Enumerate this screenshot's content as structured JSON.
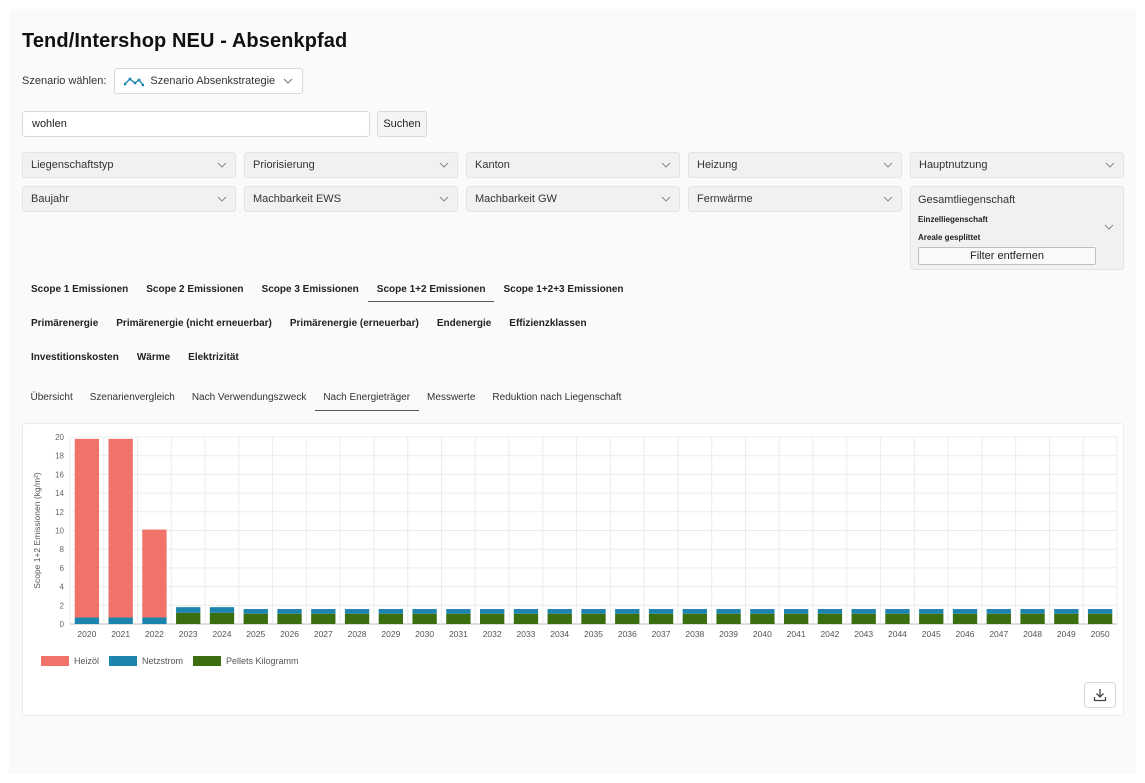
{
  "title": "Tend/Intershop NEU - Absenkpfad",
  "scenario": {
    "label": "Szenario wählen:",
    "selected": "Szenario Absenkstrategie",
    "icon": "line-chart-icon"
  },
  "search": {
    "value": "wohlen",
    "button": "Suchen"
  },
  "filters": {
    "row1": [
      "Liegenschaftstyp",
      "Priorisierung",
      "Kanton",
      "Heizung",
      "Hauptnutzung"
    ],
    "row2": [
      "Baujahr",
      "Machbarkeit EWS",
      "Machbarkeit GW",
      "Fernwärme"
    ],
    "gesamt": {
      "title": "Gesamtliegenschaft",
      "options": [
        "Einzelliegenschaft",
        "Areale gesplittet"
      ],
      "remove_button": "Filter entfernen"
    }
  },
  "metric_tabs": {
    "row1": [
      "Scope 1 Emissionen",
      "Scope 2 Emissionen",
      "Scope 3 Emissionen",
      "Scope 1+2 Emissionen",
      "Scope 1+2+3 Emissionen"
    ],
    "row2": [
      "Primärenergie",
      "Primärenergie (nicht erneuerbar)",
      "Primärenergie (erneuerbar)",
      "Endenergie",
      "Effizienzklassen"
    ],
    "row3": [
      "Investitionskosten",
      "Wärme",
      "Elektrizität"
    ],
    "active": "Scope 1+2 Emissionen"
  },
  "view_tabs": {
    "items": [
      "Übersicht",
      "Szenarienvergleich",
      "Nach Verwendungszweck",
      "Nach Energieträger",
      "Messwerte",
      "Reduktion nach Liegenschaft"
    ],
    "active": "Nach Energieträger"
  },
  "chart_data": {
    "type": "bar",
    "stacked": true,
    "ylabel": "Scope 1+2 Emissionen (kg/m²)",
    "xlabel": "",
    "ylim": [
      0,
      20
    ],
    "yticks": [
      0,
      2,
      4,
      6,
      8,
      10,
      12,
      14,
      16,
      18,
      20
    ],
    "grid": true,
    "legend": "bottom-left",
    "categories": [
      "2020",
      "2021",
      "2022",
      "2023",
      "2024",
      "2025",
      "2026",
      "2027",
      "2028",
      "2029",
      "2030",
      "2031",
      "2032",
      "2033",
      "2034",
      "2035",
      "2036",
      "2037",
      "2038",
      "2039",
      "2040",
      "2041",
      "2042",
      "2043",
      "2044",
      "2045",
      "2046",
      "2047",
      "2048",
      "2049",
      "2050"
    ],
    "series": [
      {
        "name": "Pellets Kilogramm",
        "color": "#3a6e0f",
        "values": [
          0,
          0,
          0,
          1.2,
          1.2,
          1.1,
          1.1,
          1.1,
          1.1,
          1.1,
          1.1,
          1.1,
          1.1,
          1.1,
          1.1,
          1.1,
          1.1,
          1.1,
          1.1,
          1.1,
          1.1,
          1.1,
          1.1,
          1.1,
          1.1,
          1.1,
          1.1,
          1.1,
          1.1,
          1.1,
          1.1
        ]
      },
      {
        "name": "Netzstrom",
        "color": "#1c84ad",
        "values": [
          0.7,
          0.7,
          0.7,
          0.6,
          0.6,
          0.5,
          0.5,
          0.5,
          0.5,
          0.5,
          0.5,
          0.5,
          0.5,
          0.5,
          0.5,
          0.5,
          0.5,
          0.5,
          0.5,
          0.5,
          0.5,
          0.5,
          0.5,
          0.5,
          0.5,
          0.5,
          0.5,
          0.5,
          0.5,
          0.5,
          0.5
        ]
      },
      {
        "name": "Heizöl",
        "color": "#f07268",
        "values": [
          19.1,
          19.1,
          9.4,
          0,
          0,
          0,
          0,
          0,
          0,
          0,
          0,
          0,
          0,
          0,
          0,
          0,
          0,
          0,
          0,
          0,
          0,
          0,
          0,
          0,
          0,
          0,
          0,
          0,
          0,
          0,
          0
        ]
      }
    ],
    "legend_order": [
      "Heizöl",
      "Netzstrom",
      "Pellets Kilogramm"
    ]
  },
  "download_icon": "download-icon"
}
